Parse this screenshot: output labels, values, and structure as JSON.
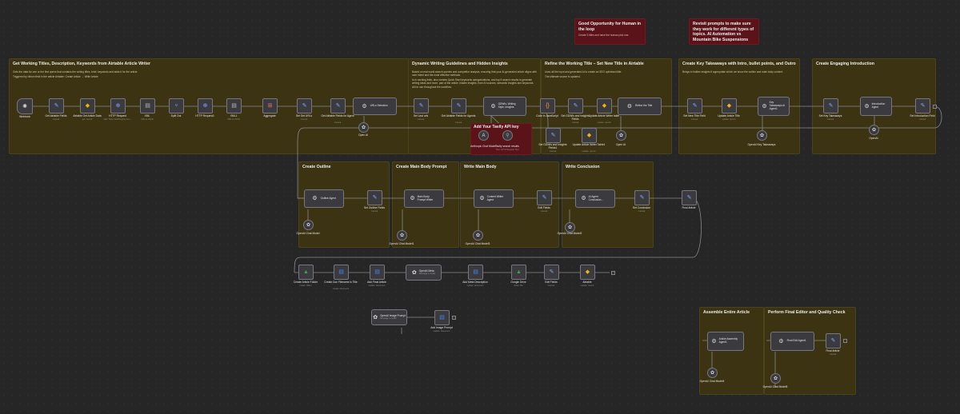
{
  "colors": {
    "canvas": "#262626",
    "sticky_yellow": "#3b3312",
    "sticky_red": "#5a1419",
    "node_fill": "#3a3a3f",
    "wire": "#8a8a8a"
  },
  "notes": {
    "human_loop": {
      "title": "Good Opportunity for Human in the loop",
      "body": "Create 3 titles and have the human pick one."
    },
    "revisit": {
      "title": "Revisit prompts to make sure they work for different types of topics. AI Automation vs Mountain Bike Suspensions"
    },
    "get_titles": {
      "title": "Get Working Titles, Description, Keywords from Airtable Article Writer",
      "body": "Gets the data for one or the first opens that contains the writing titles, brief, keywords and adds it for the article.",
      "body2": "Triggered by ribbon field in the article Airtable: Create Article → Write Article"
    },
    "guidelines": {
      "title": "Dynamic Writing Guidelines and Hidden Insights",
      "body": "Based on real world search queries and competitor analysis, ensuring that your AI-generated article aligns with user intent and the most effective methods.",
      "body2": "Is in caching links, also creates Quick Start keywords categorizations, and top 5 search results to generate writing ideas and more. part of the article, hidden insights, from AI sources, semantic insights and keywords. All for use throughout the workflow."
    },
    "refine": {
      "title": "Refine the Working Title – Set New Title in Airtable",
      "body": "Uses all the input and generated AI to create an SEO optimised title.",
      "body2": "The ultimate source is updated."
    },
    "takeaways": {
      "title": "Create Key Takeaways with Intro, bullet points, and Outro",
      "body": "Brings in hidden insights if appropriate which we know the outline and main body content."
    },
    "intro": {
      "title": "Create Engaging Introduction"
    },
    "outline": {
      "title": "Create Outline"
    },
    "main_prompt": {
      "title": "Create Main Body Prompt"
    },
    "main_body": {
      "title": "Write Main Body"
    },
    "conclusion": {
      "title": "Write Conclusion"
    },
    "assemble": {
      "title": "Assemble Entire Article"
    },
    "final_editor": {
      "title": "Perform Final Editor and Quality Check"
    },
    "tavily": {
      "title": "Add Your Tavily API key"
    }
  },
  "nodes": {
    "webhook": {
      "label": "Webhook",
      "sub": ""
    },
    "set_fields": {
      "label": "Get Airtable Fields",
      "sub": "manual"
    },
    "airtable_get": {
      "label": "Airtable Get Article Data",
      "sub": "get: record"
    },
    "http1": {
      "label": "HTTP Request",
      "sub": "GET: https://trafficsights.com..."
    },
    "xml": {
      "label": "XML",
      "sub": "XML to JSON"
    },
    "split_out": {
      "label": "Split Out",
      "sub": ""
    },
    "http2": {
      "label": "HTTP Request1",
      "sub": ""
    },
    "xml1": {
      "label": "XML1",
      "sub": "XML to JSON"
    },
    "aggregate": {
      "label": "Aggregate",
      "sub": ""
    },
    "set_urls": {
      "label": "Set Get URLs",
      "sub": "manual"
    },
    "get_fields_agent": {
      "label": "Get Airtable Fields for Agent",
      "sub": "manual"
    },
    "urls_selection": {
      "label": "URLs Selection",
      "sub": ""
    },
    "openai_top": {
      "label": "Open AI",
      "sub": ""
    },
    "set_last_urls": {
      "label": "Set Last urls",
      "sub": "manual"
    },
    "get_fields_agents": {
      "label": "Get Airtable Fields for Agents",
      "sub": "manual"
    },
    "gdwi": {
      "label": "GDWIs, Writing Style, Insights",
      "sub": ""
    },
    "anthropic": {
      "label": "Anthropic Chat Model",
      "sub": ""
    },
    "tavily": {
      "label": "Tavily search results",
      "sub": "Tool: HTTP Request Tool"
    },
    "code_js": {
      "label": "Code in JavaScript",
      "sub": ""
    },
    "set_gdwi": {
      "label": "Set GDWIs and Insights Fields",
      "sub": "manual"
    },
    "update_writer": {
      "label": "Update Article Writer table",
      "sub": "update: record"
    },
    "refine_title": {
      "label": "Refine the Title",
      "sub": ""
    },
    "set_gdwi2": {
      "label": "Set GDWIs and Insights Fields1",
      "sub": "manual"
    },
    "update_writer2": {
      "label": "Update Article Writer Table1",
      "sub": "update: record"
    },
    "openai_refine": {
      "label": "Open AI",
      "sub": ""
    },
    "set_new_title": {
      "label": "Set New Title Field",
      "sub": "manual"
    },
    "update_title": {
      "label": "Update Article Title",
      "sub": "update: record"
    },
    "key_takeaways": {
      "label": "Key Takeaways AI Agent1",
      "sub": ""
    },
    "openai_kt": {
      "label": "OpenAI Key Takeaways",
      "sub": ""
    },
    "set_takeaways": {
      "label": "Set Key Takeaways",
      "sub": "manual"
    },
    "intro_agent": {
      "label": "Introduction Agent",
      "sub": ""
    },
    "set_intro": {
      "label": "Set Introduction Field",
      "sub": "manual"
    },
    "openai_intro": {
      "label": "OpenAI",
      "sub": ""
    },
    "outline_agent": {
      "label": "Outline Agent",
      "sub": ""
    },
    "set_outline": {
      "label": "Set Outline Fields",
      "sub": "manual"
    },
    "openai_outline": {
      "label": "OpenAI Chat Model",
      "sub": ""
    },
    "main_body_prompt": {
      "label": "Main Body Prompt Writer",
      "sub": ""
    },
    "openai_mbp": {
      "label": "OpenAI Chat Model1",
      "sub": ""
    },
    "content_writer": {
      "label": "Content Writer Agent",
      "sub": ""
    },
    "openai_cw": {
      "label": "OpenAI Chat Model3",
      "sub": ""
    },
    "edit_fields": {
      "label": "Edit Fields",
      "sub": "manual"
    },
    "conclusion_agent": {
      "label": "AI Agent Conclusion...",
      "sub": ""
    },
    "openai_concl": {
      "label": "OpenAI Chat Model2",
      "sub": ""
    },
    "set_conclusion": {
      "label": "Set Conclusion",
      "sub": "manual"
    },
    "final_article": {
      "label": "Final Article",
      "sub": ""
    },
    "create_folder": {
      "label": "Create Article Folder",
      "sub": "create: folder"
    },
    "create_doc": {
      "label": "Create Doc Filename is Title",
      "sub": "create: document"
    },
    "add_final": {
      "label": "Add Final Article",
      "sub": "update: document"
    },
    "openai_meta": {
      "label": "OpenAI Meta",
      "sub": "Message a model"
    },
    "add_meta": {
      "label": "Add Meta Description",
      "sub": "update: document"
    },
    "google_drive": {
      "label": "Google Drive",
      "sub": "share: file"
    },
    "edit_fields2": {
      "label": "Edit Fields",
      "sub": "manual"
    },
    "airtable_end": {
      "label": "Airtable",
      "sub": "update: record"
    },
    "openai_image": {
      "label": "OpenAI Image Prompt",
      "sub": "Message a model"
    },
    "add_image": {
      "label": "Add Image Prompt",
      "sub": "update: document"
    },
    "assembly_agent": {
      "label": "Article Assembly Agent1",
      "sub": ""
    },
    "openai_assembly": {
      "label": "OpenAI Chat Model4",
      "sub": ""
    },
    "final_edit_agent": {
      "label": "Final Edit Agent1",
      "sub": ""
    },
    "openai_final": {
      "label": "OpenAI Chat Model5",
      "sub": ""
    },
    "final_article2": {
      "label": "Final Article",
      "sub": "manual"
    }
  }
}
